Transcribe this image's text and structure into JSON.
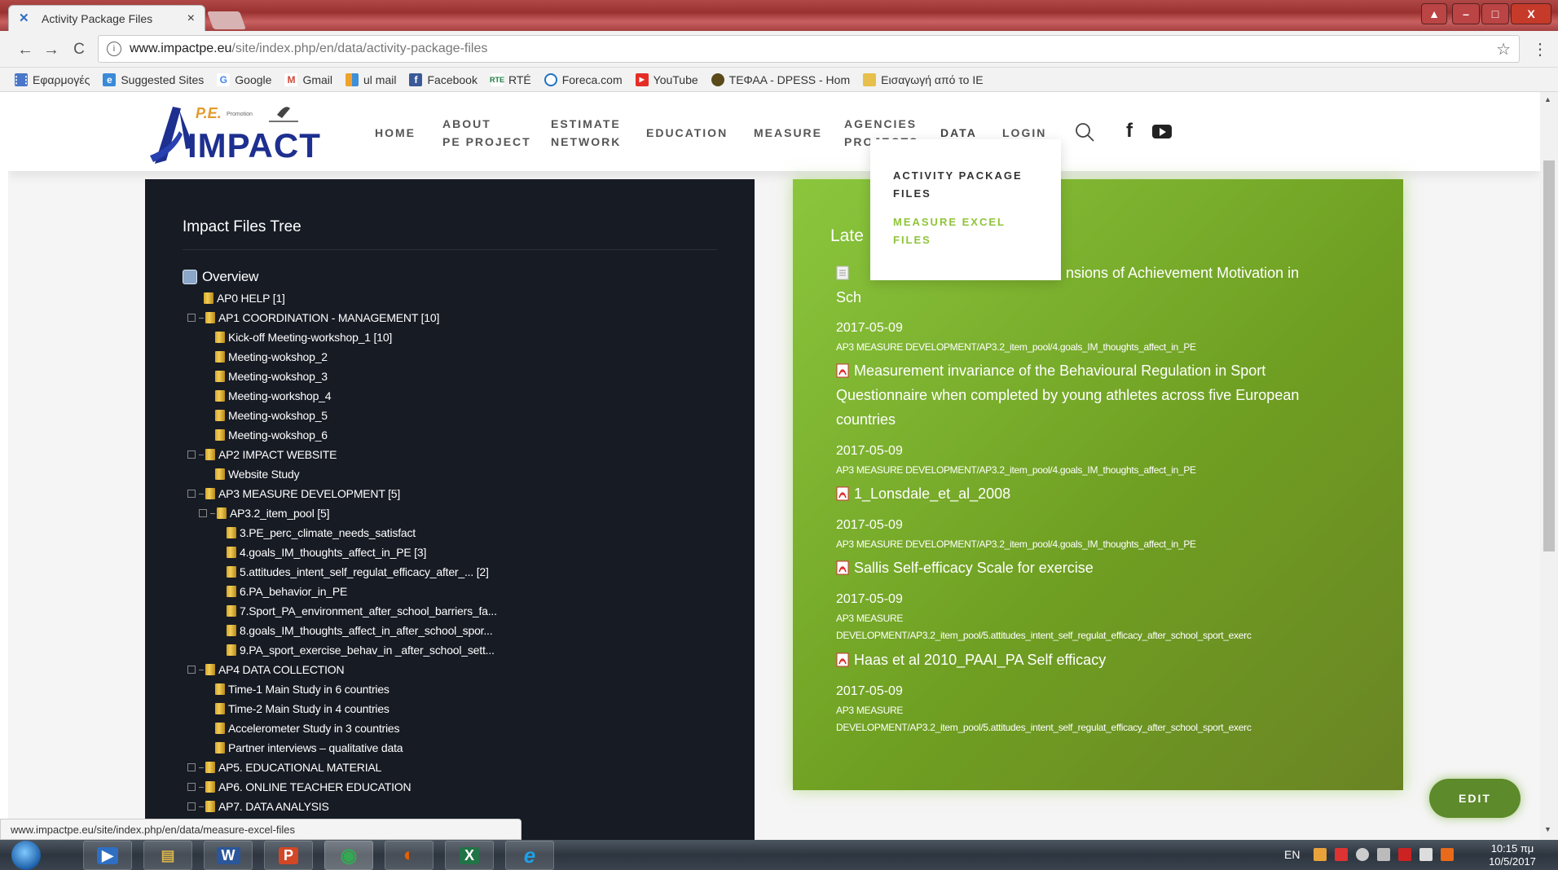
{
  "browser": {
    "tab_title": "Activity Package Files",
    "tab_close": "×",
    "url_domain": "www.impactpe.eu",
    "url_path": "/site/index.php/en/data/activity-package-files",
    "back": "←",
    "forward": "→",
    "reload": "C",
    "info": "i",
    "star": "☆",
    "menu": "⋮",
    "window_buttons": [
      "▲",
      "–",
      "□",
      "X"
    ],
    "bookmarks": [
      {
        "label": "Εφαρμογές",
        "icon": "apps-grid-icon",
        "color": "#4a77c9"
      },
      {
        "label": "Suggested Sites",
        "icon": "ie-icon",
        "color": "#3a8ad8"
      },
      {
        "label": "Google",
        "icon": "google-icon",
        "color": "#4285f4"
      },
      {
        "label": "Gmail",
        "icon": "gmail-icon",
        "color": "#d44638"
      },
      {
        "label": "ul mail",
        "icon": "mail-icon",
        "color": "#f1a22c"
      },
      {
        "label": "Facebook",
        "icon": "facebook-icon",
        "color": "#3b5998"
      },
      {
        "label": "RTÉ",
        "icon": "rte-icon",
        "color": "#1b7a3e"
      },
      {
        "label": "Foreca.com",
        "icon": "foreca-icon",
        "color": "#1f72c5"
      },
      {
        "label": "YouTube",
        "icon": "youtube-icon",
        "color": "#e52d27"
      },
      {
        "label": "ΤΕΦΑΑ - DPESS - Hom",
        "icon": "tefaa-icon",
        "color": "#5a4a1a"
      },
      {
        "label": "Εισαγωγή από το IE",
        "icon": "folder-icon",
        "color": "#e6c04b"
      }
    ],
    "status_url": "www.impactpe.eu/site/index.php/en/data/measure-excel-files"
  },
  "site": {
    "logo_top": "P.E.",
    "logo_small": "Promotion",
    "logo_main": "IMPACT",
    "nav": [
      {
        "line1": "HOME",
        "line2": ""
      },
      {
        "line1": "ABOUT",
        "line2": "PE PROJECT"
      },
      {
        "line1": "ESTIMATE",
        "line2": "NETWORK"
      },
      {
        "line1": "EDUCATION",
        "line2": ""
      },
      {
        "line1": "MEASURE",
        "line2": ""
      },
      {
        "line1": "AGENCIES",
        "line2": "PROJECTS"
      },
      {
        "line1": "DATA",
        "line2": ""
      },
      {
        "line1": "LOGIN",
        "line2": ""
      }
    ],
    "social": {
      "facebook": "f"
    },
    "accent": "#7ab536",
    "dropdown": [
      {
        "line1": "ACTIVITY PACKAGE",
        "line2": "FILES",
        "color": "#333333"
      },
      {
        "line1": "MEASURE EXCEL",
        "line2": "FILES",
        "color": "#8fc43a"
      }
    ],
    "edit_label": "EDIT"
  },
  "tree": {
    "title": "Impact Files Tree",
    "overview": "Overview",
    "nodes": [
      {
        "label": "AP0 HELP [1]"
      },
      {
        "label": "AP1 COORDINATION - MANAGEMENT [10]"
      },
      {
        "label": "Kick-off Meeting-workshop_1 [10]"
      },
      {
        "label": "Meeting-wokshop_2"
      },
      {
        "label": "Meeting-wokshop_3"
      },
      {
        "label": "Meeting-workshop_4"
      },
      {
        "label": "Meeting-wokshop_5"
      },
      {
        "label": "Meeting-wokshop_6"
      },
      {
        "label": "AP2 IMPACT WEBSITE"
      },
      {
        "label": "Website Study"
      },
      {
        "label": "AP3 MEASURE DEVELOPMENT [5]"
      },
      {
        "label": "AP3.2_item_pool [5]"
      },
      {
        "label": "3.PE_perc_climate_needs_satisfact"
      },
      {
        "label": "4.goals_IM_thoughts_affect_in_PE [3]"
      },
      {
        "label": "5.attitudes_intent_self_regulat_efficacy_after_... [2]"
      },
      {
        "label": "6.PA_behavior_in_PE"
      },
      {
        "label": "7.Sport_PA_environment_after_school_barriers_fa..."
      },
      {
        "label": "8.goals_IM_thoughts_affect_in_after_school_spor..."
      },
      {
        "label": "9.PA_sport_exercise_behav_in _after_school_sett..."
      },
      {
        "label": "AP4 DATA COLLECTION"
      },
      {
        "label": "Time-1 Main Study in 6 countries"
      },
      {
        "label": "Time-2 Main Study in 4 countries"
      },
      {
        "label": "Accelerometer Study in 3 countries"
      },
      {
        "label": "Partner interviews – qualitative data"
      },
      {
        "label": "AP5. EDUCATIONAL MATERIAL"
      },
      {
        "label": "AP6. ONLINE TEACHER EDUCATION"
      },
      {
        "label": "AP7. DATA ANALYSIS"
      }
    ]
  },
  "latest": {
    "title": "Late",
    "first_doc_visible": "nsions of Achievement Motivation in",
    "first_doc_line2": "Sch",
    "items": [
      {
        "date": "2017-05-09",
        "path": "AP3 MEASURE DEVELOPMENT/AP3.2_item_pool/4.goals_IM_thoughts_affect_in_PE",
        "title_lines": [
          "Measurement invariance of the Behavioural Regulation in Sport",
          "Questionnaire when completed by young athletes across five European",
          "countries"
        ]
      },
      {
        "date": "2017-05-09",
        "path": "AP3 MEASURE DEVELOPMENT/AP3.2_item_pool/4.goals_IM_thoughts_affect_in_PE",
        "title_lines": [
          "1_Lonsdale_et_al_2008"
        ]
      },
      {
        "date": "2017-05-09",
        "path": "AP3 MEASURE DEVELOPMENT/AP3.2_item_pool/4.goals_IM_thoughts_affect_in_PE",
        "title_lines": [
          "Sallis Self-efficacy Scale for exercise"
        ]
      },
      {
        "date": "2017-05-09",
        "path_lines": [
          "AP3 MEASURE",
          "DEVELOPMENT/AP3.2_item_pool/5.attitudes_intent_self_regulat_efficacy_after_school_sport_exerc"
        ],
        "title_lines": [
          "Haas et al 2010_PAAI_PA Self efficacy"
        ]
      },
      {
        "date": "2017-05-09",
        "path_lines": [
          "AP3 MEASURE",
          "DEVELOPMENT/AP3.2_item_pool/5.attitudes_intent_self_regulat_efficacy_after_school_sport_exerc"
        ]
      }
    ]
  },
  "taskbar": {
    "apps": [
      {
        "name": "media-player",
        "glyph": "▶",
        "color": "#2f6fc3"
      },
      {
        "name": "file-explorer",
        "glyph": "▤",
        "color": "#d9b24a"
      },
      {
        "name": "word",
        "glyph": "W",
        "color": "#2b579a"
      },
      {
        "name": "powerpoint",
        "glyph": "P",
        "color": "#d24726"
      },
      {
        "name": "chrome",
        "glyph": "◉",
        "color": "#34a853"
      },
      {
        "name": "firefox",
        "glyph": "◐",
        "color": "#e66000"
      },
      {
        "name": "excel",
        "glyph": "X",
        "color": "#217346"
      },
      {
        "name": "internet-explorer",
        "glyph": "e",
        "color": "#1ea0e6"
      }
    ],
    "lang": "EN",
    "time": "10:15 πμ",
    "date": "10/5/2017"
  }
}
